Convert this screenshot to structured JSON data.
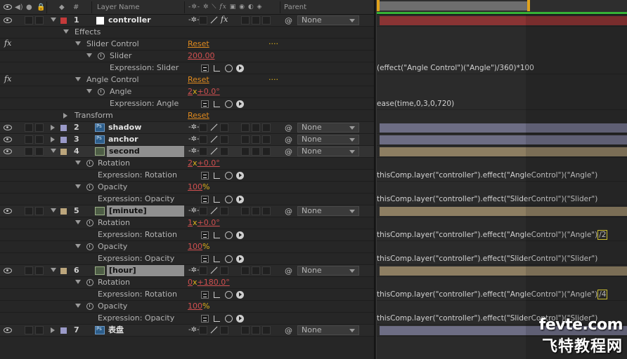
{
  "header": {
    "num_col": "#",
    "layer_name_col": "Layer Name",
    "parent_col": "Parent"
  },
  "rows": {
    "r1": {
      "num": "1",
      "name": "controller",
      "color": "#c43a3a",
      "parent": "None"
    },
    "effects": "Effects",
    "slider_control": {
      "label": "Slider Control",
      "reset": "Reset",
      "dots": "...."
    },
    "slider": {
      "label": "Slider",
      "value": "200.00"
    },
    "expr_slider": {
      "label": "Expression: Slider"
    },
    "angle_control": {
      "label": "Angle Control",
      "reset": "Reset",
      "dots": "...."
    },
    "angle": {
      "label": "Angle",
      "value_prefix": "2",
      "value_x": "x",
      "value_rest": "+0.0°"
    },
    "expr_angle": {
      "label": "Expression: Angle"
    },
    "transform": {
      "label": "Transform",
      "reset": "Reset"
    },
    "r2": {
      "num": "2",
      "name": "shadow",
      "color": "#9a9ac8",
      "parent": "None"
    },
    "r3": {
      "num": "3",
      "name": "anchor",
      "color": "#9a9ac8",
      "parent": "None"
    },
    "r4": {
      "num": "4",
      "name": "second",
      "color": "#bca67c",
      "parent": "None"
    },
    "r4_rot": {
      "label": "Rotation",
      "value_prefix": "2",
      "value_x": "x",
      "value_rest": "+0.0°"
    },
    "r4_expr_rot": {
      "label": "Expression: Rotation"
    },
    "r4_op": {
      "label": "Opacity",
      "value": "100",
      "unit": "%"
    },
    "r4_expr_op": {
      "label": "Expression: Opacity"
    },
    "r5": {
      "num": "5",
      "name": "[minute]",
      "color": "#bca67c",
      "parent": "None"
    },
    "r5_rot": {
      "label": "Rotation",
      "value_prefix": "1",
      "value_x": "x",
      "value_rest": "+0.0°"
    },
    "r5_expr_rot": {
      "label": "Expression: Rotation"
    },
    "r5_op": {
      "label": "Opacity",
      "value": "100",
      "unit": "%"
    },
    "r5_expr_op": {
      "label": "Expression: Opacity"
    },
    "r6": {
      "num": "6",
      "name": "[hour]",
      "color": "#bca67c",
      "parent": "None"
    },
    "r6_rot": {
      "label": "Rotation",
      "value_prefix": "0",
      "value_x": "x",
      "value_rest": "+180.0°"
    },
    "r6_expr_rot": {
      "label": "Expression: Rotation"
    },
    "r6_op": {
      "label": "Opacity",
      "value": "100",
      "unit": "%"
    },
    "r6_expr_op": {
      "label": "Expression: Opacity"
    },
    "r7": {
      "num": "7",
      "name": "表盘",
      "color": "#9a9ac8",
      "parent": "None"
    }
  },
  "expressions": {
    "slider": "(effect(\"Angle Control\")(\"Angle\")/360)*100",
    "angle": "ease(time,0,3,0,720)",
    "r4_rot": "thisComp.layer(\"controller\").effect(\"AngleControl\")(\"Angle\")",
    "r4_op": "thisComp.layer(\"controller\").effect(\"SliderControl\")(\"Slider\")",
    "r5_rot": "thisComp.layer(\"controller\").effect(\"AngleControl\")(\"Angle\")",
    "r5_rot_hl": "/2",
    "r5_op": "thisComp.layer(\"controller\").effect(\"SliderControl\")(\"Slider\")",
    "r6_rot": "thisComp.layer(\"controller\").effect(\"AngleControl\")(\"Angle\")",
    "r6_rot_hl": "/4",
    "r6_op": "thisComp.layer(\"controller\").effect(\"SliderControl\")(\"Slider\")"
  },
  "colors": {
    "controller_bar": "#8a3434",
    "shadow_bar": "#6d6d84",
    "footage_bar": "#8d7e62",
    "work_area": "#6e6e6e",
    "green_line": "#36b336",
    "expression_highlight": "#e8d83a"
  },
  "watermark": {
    "line1": "fevte.com",
    "line2": "飞特教程网"
  }
}
